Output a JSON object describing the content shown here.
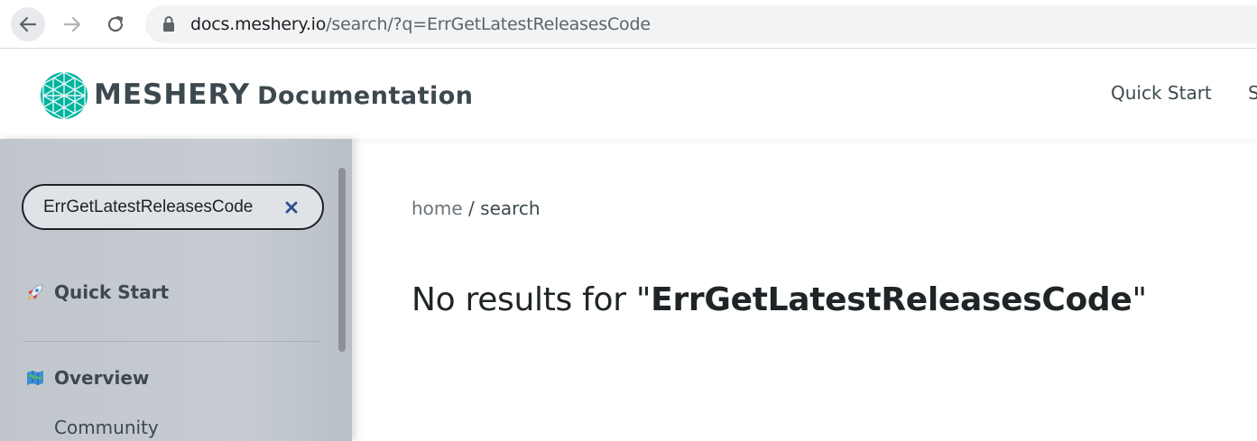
{
  "browser": {
    "url_host": "docs.meshery.io",
    "url_path": "/search/?q=ErrGetLatestReleasesCode",
    "icons": [
      "back-arrow-icon",
      "forward-arrow-icon",
      "reload-icon",
      "lock-icon"
    ]
  },
  "header": {
    "brand_name": "MESHERY",
    "brand_suffix": "Documentation",
    "nav": [
      "Quick Start",
      "S"
    ],
    "colors": {
      "logo": "#00b39f",
      "text": "#3c494f"
    }
  },
  "sidebar": {
    "search_value": "ErrGetLatestReleasesCode",
    "items": [
      {
        "label": "Quick Start",
        "icon": "rocket-icon"
      },
      {
        "label": "Overview",
        "icon": "map-icon"
      }
    ],
    "sub_items": [
      "Community"
    ]
  },
  "main": {
    "breadcrumb_home": "home",
    "breadcrumb_sep": " / ",
    "breadcrumb_current": "search",
    "result_prefix": "No results for \"",
    "result_query": "ErrGetLatestReleasesCode",
    "result_suffix": "\""
  }
}
